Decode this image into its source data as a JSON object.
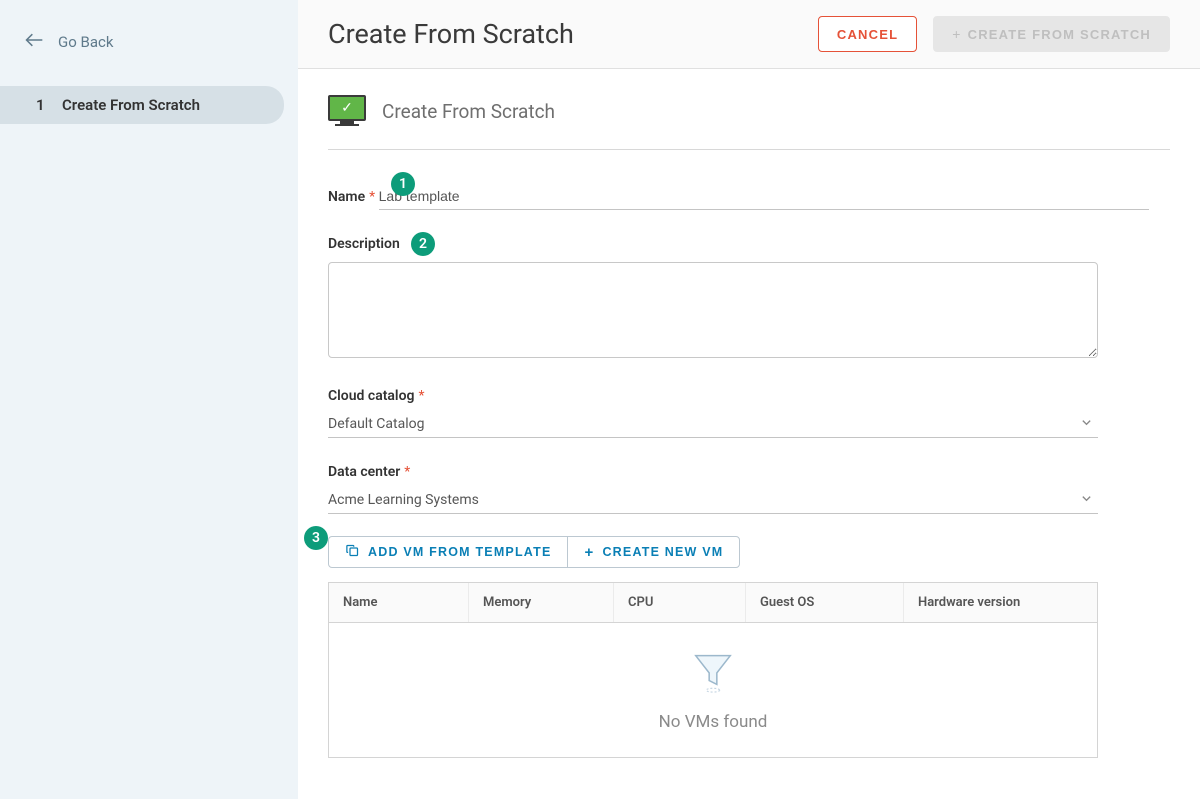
{
  "sidebar": {
    "go_back": "Go Back",
    "steps": [
      {
        "num": "1",
        "label": "Create From Scratch"
      }
    ]
  },
  "header": {
    "title": "Create From Scratch",
    "cancel_label": "CANCEL",
    "create_label": "CREATE FROM SCRATCH"
  },
  "section": {
    "title": "Create From Scratch"
  },
  "form": {
    "name_label": "Name",
    "name_value": "Lab template",
    "desc_label": "Description",
    "desc_value": "",
    "catalog_label": "Cloud catalog",
    "catalog_value": "Default Catalog",
    "datacenter_label": "Data center",
    "datacenter_value": "Acme Learning Systems"
  },
  "actions": {
    "add_template": "ADD VM FROM TEMPLATE",
    "create_vm": "CREATE NEW VM"
  },
  "table": {
    "headers": {
      "name": "Name",
      "memory": "Memory",
      "cpu": "CPU",
      "guest_os": "Guest OS",
      "hardware": "Hardware version"
    },
    "empty": "No VMs found"
  },
  "callouts": {
    "one": "1",
    "two": "2",
    "three": "3"
  }
}
